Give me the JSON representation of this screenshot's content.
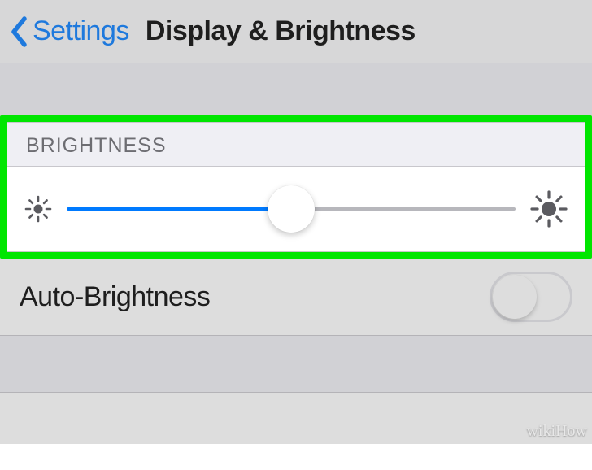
{
  "header": {
    "back_label": "Settings",
    "title": "Display & Brightness"
  },
  "brightness": {
    "section_label": "BRIGHTNESS",
    "slider_percent": 50
  },
  "auto_brightness": {
    "label": "Auto-Brightness",
    "enabled": false
  },
  "colors": {
    "accent": "#007aff",
    "highlight": "#00e600"
  },
  "watermark": "wikiHow"
}
